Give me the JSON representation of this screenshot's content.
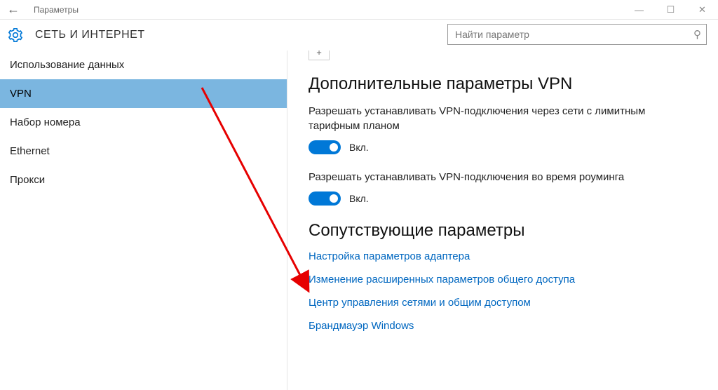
{
  "window": {
    "title": "Параметры"
  },
  "header": {
    "page_title": "СЕТЬ И ИНТЕРНЕТ",
    "search_placeholder": "Найти параметр"
  },
  "sidebar": {
    "items": [
      {
        "label": "Использование данных",
        "selected": false
      },
      {
        "label": "VPN",
        "selected": true
      },
      {
        "label": "Набор номера",
        "selected": false
      },
      {
        "label": "Ethernet",
        "selected": false
      },
      {
        "label": "Прокси",
        "selected": false
      }
    ]
  },
  "content": {
    "advanced_heading": "Дополнительные параметры VPN",
    "metered": {
      "label": "Разрешать устанавливать VPN-подключения через сети с лимитным тарифным планом",
      "state": "Вкл."
    },
    "roaming": {
      "label": "Разрешать устанавливать VPN-подключения во время роуминга",
      "state": "Вкл."
    },
    "related_heading": "Сопутствующие параметры",
    "links": [
      "Настройка параметров адаптера",
      "Изменение расширенных параметров общего доступа",
      "Центр управления сетями и общим доступом",
      "Брандмауэр Windows"
    ]
  },
  "annotation": {
    "arrow_color": "#e60000"
  }
}
